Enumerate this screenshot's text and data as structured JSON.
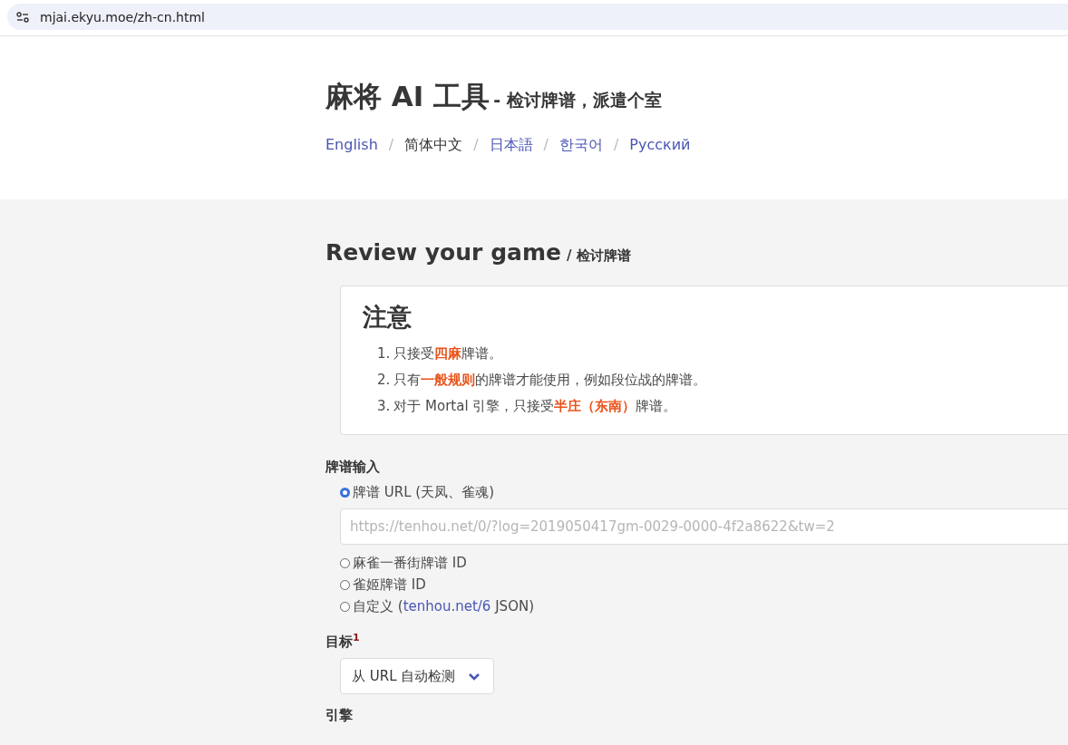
{
  "address_bar": {
    "url": "mjai.ekyu.moe/zh-cn.html"
  },
  "header": {
    "title": "麻将 AI 工具",
    "subtitle": "- 检讨牌谱，派遣个室",
    "languages": [
      {
        "label": "English",
        "selected": false
      },
      {
        "separator": "/",
        "label": "简体中文",
        "selected": true
      },
      {
        "separator": "/",
        "label": "日本語",
        "selected": false
      },
      {
        "separator": "/",
        "label": "한국어",
        "selected": false
      },
      {
        "separator": "/",
        "label": "Русский",
        "selected": false
      }
    ]
  },
  "review": {
    "title": "Review your game",
    "subtitle": "/ 检讨牌谱",
    "notice": {
      "heading": "注意",
      "items": [
        {
          "marker": "1.",
          "text": "只接受**四麻**牌谱。"
        },
        {
          "marker": "2.",
          "text": "只有**一般规则**的牌谱才能使用，例如段位战的牌谱。"
        },
        {
          "marker": "3.",
          "text": "对于 Mortal 引擎，只接受**半庄（东南）**牌谱。"
        }
      ]
    },
    "log_input": {
      "label": "牌谱输入",
      "options": [
        {
          "label": "牌谱 URL (天凤、雀魂)",
          "selected": true,
          "placeholder": "https://tenhou.net/0/?log=2019050417gm-0029-0000-4f2a8622&tw=2"
        },
        {
          "label": "麻雀一番街牌谱 ID",
          "selected": false
        },
        {
          "label": "雀姬牌谱 ID",
          "selected": false
        },
        {
          "label": "自定义 (",
          "link": "tenhou.net/6",
          "label_after": " JSON)",
          "selected": false
        }
      ]
    },
    "target": {
      "label": "目标$^{1}$",
      "value": "从 URL 自动检测"
    },
    "engine": {
      "label": "引擎"
    }
  }
}
